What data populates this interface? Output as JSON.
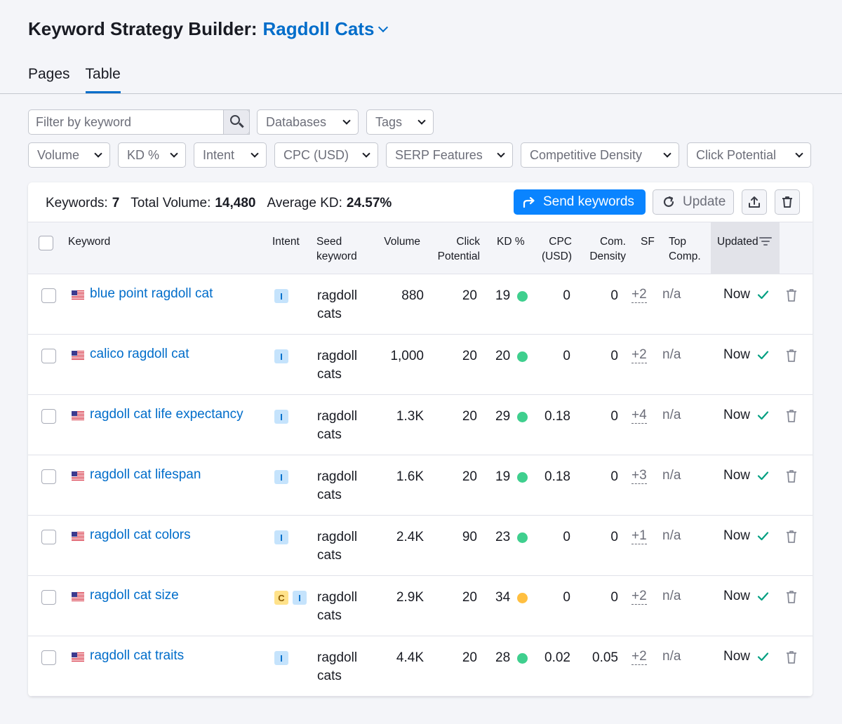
{
  "header": {
    "title": "Keyword Strategy Builder:",
    "project": "Ragdoll Cats"
  },
  "tabs": [
    {
      "label": "Pages",
      "active": false
    },
    {
      "label": "Table",
      "active": true
    }
  ],
  "filters": {
    "search_placeholder": "Filter by keyword",
    "databases": "Databases",
    "tags": "Tags",
    "volume": "Volume",
    "kd": "KD %",
    "intent": "Intent",
    "cpc": "CPC (USD)",
    "serp": "SERP Features",
    "density": "Competitive Density",
    "click": "Click Potential"
  },
  "summary": {
    "keywords_label": "Keywords:",
    "keywords_value": "7",
    "volume_label": "Total Volume:",
    "volume_value": "14,480",
    "kd_label": "Average KD:",
    "kd_value": "24.57%"
  },
  "actions": {
    "send": "Send keywords",
    "update": "Update"
  },
  "columns": {
    "keyword": "Keyword",
    "intent": "Intent",
    "seed1": "Seed",
    "seed2": "keyword",
    "volume": "Volume",
    "click1": "Click",
    "click2": "Potential",
    "kd": "KD %",
    "cpc1": "CPC",
    "cpc2": "(USD)",
    "den1": "Com.",
    "den2": "Density",
    "sf": "SF",
    "top1": "Top",
    "top2": "Comp.",
    "updated": "Updated"
  },
  "colors": {
    "kd_easy": "#3fcf8e",
    "kd_medium": "#ffbf40",
    "accent": "#006dca"
  },
  "rows": [
    {
      "keyword": "blue point ragdoll cat",
      "intents": [
        "I"
      ],
      "seed1": "ragdoll",
      "seed2": "cats",
      "volume": "880",
      "click": "20",
      "kd": "19",
      "kd_level": "easy",
      "cpc": "0",
      "density": "0",
      "sf": "+2",
      "top": "n/a",
      "updated": "Now"
    },
    {
      "keyword": "calico ragdoll cat",
      "intents": [
        "I"
      ],
      "seed1": "ragdoll",
      "seed2": "cats",
      "volume": "1,000",
      "click": "20",
      "kd": "20",
      "kd_level": "easy",
      "cpc": "0",
      "density": "0",
      "sf": "+2",
      "top": "n/a",
      "updated": "Now"
    },
    {
      "keyword": "ragdoll cat life expectancy",
      "intents": [
        "I"
      ],
      "seed1": "ragdoll",
      "seed2": "cats",
      "volume": "1.3K",
      "click": "20",
      "kd": "29",
      "kd_level": "easy",
      "cpc": "0.18",
      "density": "0",
      "sf": "+4",
      "top": "n/a",
      "updated": "Now"
    },
    {
      "keyword": "ragdoll cat lifespan",
      "intents": [
        "I"
      ],
      "seed1": "ragdoll",
      "seed2": "cats",
      "volume": "1.6K",
      "click": "20",
      "kd": "19",
      "kd_level": "easy",
      "cpc": "0.18",
      "density": "0",
      "sf": "+3",
      "top": "n/a",
      "updated": "Now"
    },
    {
      "keyword": "ragdoll cat colors",
      "intents": [
        "I"
      ],
      "seed1": "ragdoll",
      "seed2": "cats",
      "volume": "2.4K",
      "click": "90",
      "kd": "23",
      "kd_level": "easy",
      "cpc": "0",
      "density": "0",
      "sf": "+1",
      "top": "n/a",
      "updated": "Now"
    },
    {
      "keyword": "ragdoll cat size",
      "intents": [
        "C",
        "I"
      ],
      "seed1": "ragdoll",
      "seed2": "cats",
      "volume": "2.9K",
      "click": "20",
      "kd": "34",
      "kd_level": "medium",
      "cpc": "0",
      "density": "0",
      "sf": "+2",
      "top": "n/a",
      "updated": "Now"
    },
    {
      "keyword": "ragdoll cat traits",
      "intents": [
        "I"
      ],
      "seed1": "ragdoll",
      "seed2": "cats",
      "volume": "4.4K",
      "click": "20",
      "kd": "28",
      "kd_level": "easy",
      "cpc": "0.02",
      "density": "0.05",
      "sf": "+2",
      "top": "n/a",
      "updated": "Now"
    }
  ]
}
